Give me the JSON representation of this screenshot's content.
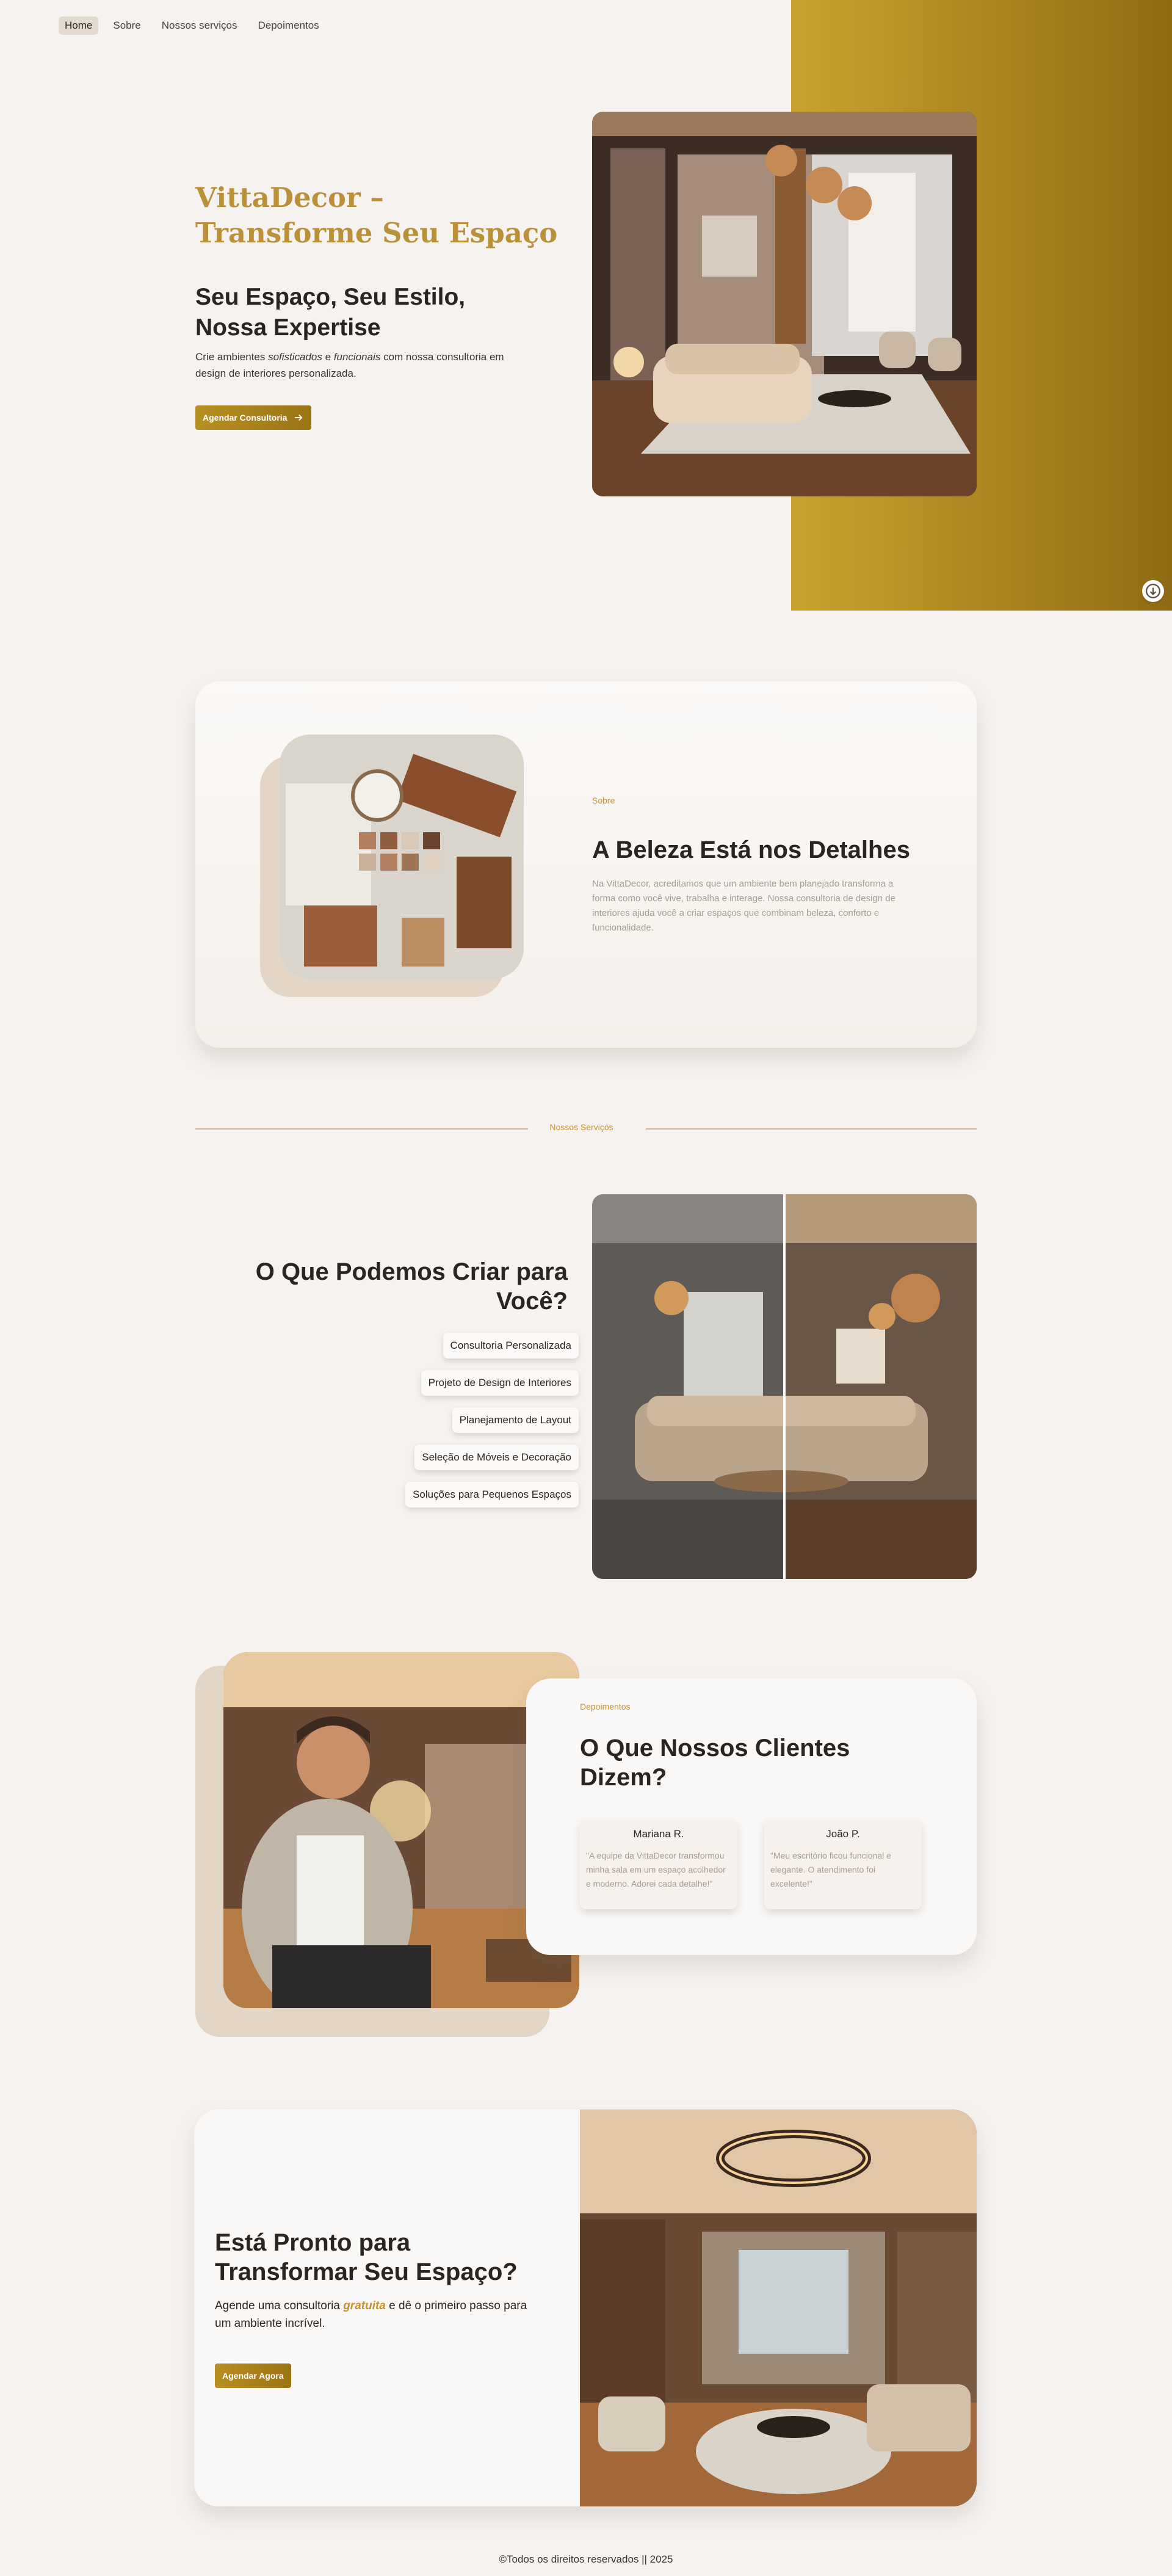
{
  "nav": {
    "items": [
      "Home",
      "Sobre",
      "Nossos serviços",
      "Depoimentos"
    ]
  },
  "hero": {
    "title": "VittaDecor – Transforme Seu Espaço",
    "subtitle": "Seu Espaço, Seu Estilo, Nossa Expertise",
    "desc_before": "Crie ambientes ",
    "desc_em1": "sofisticados",
    "desc_mid": " e ",
    "desc_em2": "funcionais",
    "desc_after": " com nossa consultoria em design de interiores personalizada.",
    "cta": "Agendar Consultoria",
    "accent": "#b9913a"
  },
  "about": {
    "label": "Sobre",
    "title": "A Beleza Está nos Detalhes",
    "text": "Na VittaDecor, acreditamos que um ambiente bem planejado transforma a forma como você vive, trabalha e interage. Nossa consultoria de design de interiores ajuda você a criar espaços que combinam beleza, conforto e funcionalidade."
  },
  "services": {
    "divider": "Nossos Serviços",
    "title": "O Que Podemos Criar para Você?",
    "items": [
      "Consultoria Personalizada",
      "Projeto de Design de Interiores",
      "Planejamento de Layout",
      "Seleção de Móveis e Decoração",
      "Soluções para Pequenos Espaços"
    ]
  },
  "testimonials": {
    "label": "Depoimentos",
    "title": "O Que Nossos Clientes Dizem?",
    "items": [
      {
        "name": "Mariana R.",
        "text": "\"A equipe da VittaDecor transformou minha sala em um espaço acolhedor e moderno. Adorei cada detalhe!\""
      },
      {
        "name": "João P.",
        "text": "\"Meu escritório ficou funcional e elegante. O atendimento foi excelente!\""
      }
    ]
  },
  "cta": {
    "title": "Está Pronto para Transformar Seu Espaço?",
    "text_before": "Agende uma consultoria ",
    "text_em": "gratuita",
    "text_after": " e dê o primeiro passo para um ambiente incrível.",
    "button": "Agendar Agora"
  },
  "footer": {
    "text": "©Todos os direitos reservados || 2025"
  },
  "icons": {
    "scroll": "arrow-down-circle-icon",
    "cta_arrow": "arrow-right-icon"
  }
}
